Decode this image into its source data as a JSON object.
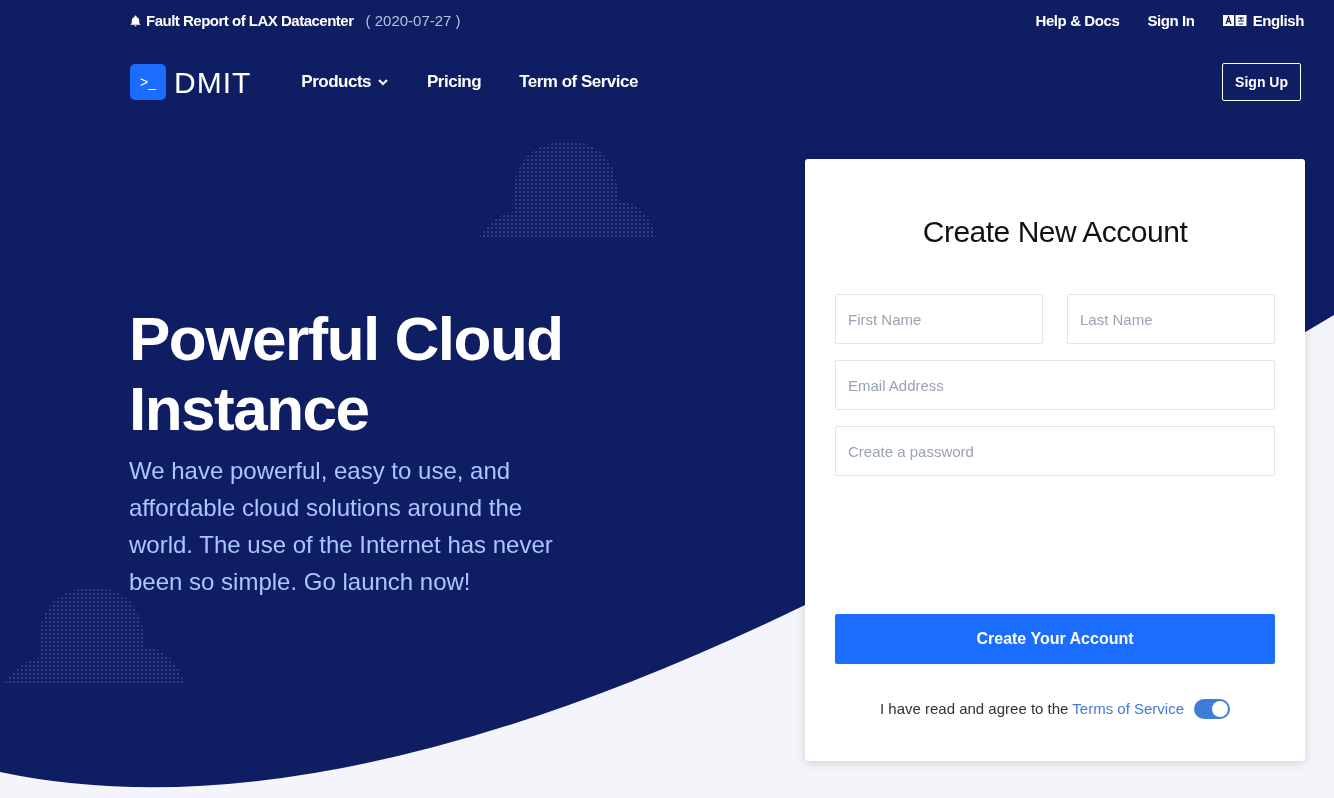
{
  "announcement": {
    "title": "Fault Report of LAX Datacenter",
    "date": "( 2020-07-27 )"
  },
  "top_links": [
    "Help & Docs",
    "Sign In"
  ],
  "language": "English",
  "logo": {
    "mark": ">_",
    "name": "DMIT"
  },
  "nav": [
    {
      "label": "Products",
      "dropdown": true
    },
    {
      "label": "Pricing",
      "dropdown": false
    },
    {
      "label": "Term of Service",
      "dropdown": false
    }
  ],
  "signup_button": "Sign Up",
  "hero": {
    "title": "Powerful Cloud Instance",
    "subtitle": "We have powerful, easy to use, and affordable cloud solutions around the world. The use of the Internet has never been so simple. Go launch now!"
  },
  "form": {
    "title": "Create New Account",
    "first_name": {
      "placeholder": "First Name"
    },
    "last_name": {
      "placeholder": "Last Name"
    },
    "email": {
      "placeholder": "Email Address"
    },
    "password": {
      "placeholder": "Create a password"
    },
    "submit": "Create Your Account",
    "agree": {
      "text": "I have read and agree to the",
      "link": "Terms of Service",
      "on": true
    }
  }
}
